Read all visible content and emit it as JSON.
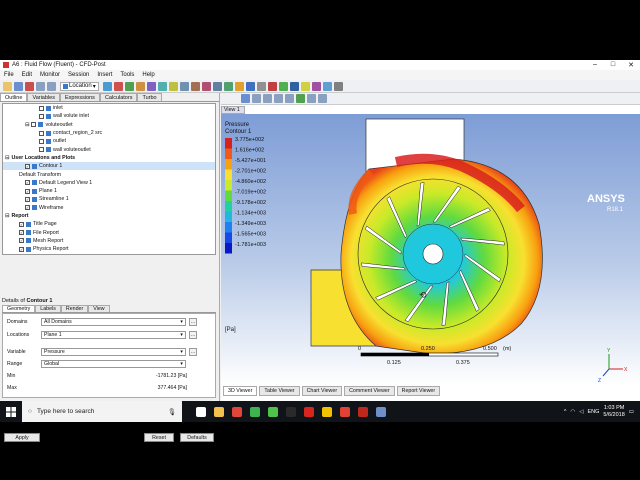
{
  "window": {
    "title": "A6 : Fluid Flow (Fluent) - CFD-Post"
  },
  "menu": [
    "File",
    "Edit",
    "Monitor",
    "Session",
    "Insert",
    "Tools",
    "Help"
  ],
  "toolbar": {
    "location_label": "Location"
  },
  "left_tabs": [
    "Outline",
    "Variables",
    "Expressions",
    "Calculators",
    "Turbo"
  ],
  "tree": [
    {
      "label": "inlet",
      "indent": 36,
      "check": false,
      "icon": true
    },
    {
      "label": "wall volute inlet",
      "indent": 36,
      "check": false,
      "icon": true
    },
    {
      "label": "voluteoutlet",
      "indent": 22,
      "check": false,
      "icon": true,
      "expander": "⊟"
    },
    {
      "label": "contact_region_2 src",
      "indent": 36,
      "check": false,
      "icon": true
    },
    {
      "label": "outlet",
      "indent": 36,
      "check": false,
      "icon": true
    },
    {
      "label": "wall voluteoutlet",
      "indent": 36,
      "check": false,
      "icon": true
    },
    {
      "label": "User Locations and Plots",
      "indent": 2,
      "bold": true,
      "expander": "⊟"
    },
    {
      "label": "Contour 1",
      "indent": 22,
      "check": true,
      "icon": true,
      "selected": true
    },
    {
      "label": "Default Transform",
      "indent": 16,
      "check": false,
      "icon": false
    },
    {
      "label": "Default Legend View 1",
      "indent": 22,
      "check": true,
      "icon": true
    },
    {
      "label": "Plane 1",
      "indent": 22,
      "check": true,
      "icon": true
    },
    {
      "label": "Streamline 1",
      "indent": 22,
      "check": true,
      "icon": true
    },
    {
      "label": "Wireframe",
      "indent": 22,
      "check": true,
      "icon": true
    },
    {
      "label": "Report",
      "indent": 2,
      "bold": true,
      "expander": "⊟"
    },
    {
      "label": "Title Page",
      "indent": 16,
      "check": true,
      "icon": true
    },
    {
      "label": "File Report",
      "indent": 16,
      "check": true,
      "icon": true
    },
    {
      "label": "Mesh Report",
      "indent": 16,
      "check": true,
      "icon": true
    },
    {
      "label": "Physics Report",
      "indent": 16,
      "check": true,
      "icon": true
    }
  ],
  "details": {
    "header_prefix": "Details of ",
    "header_name": "Contour 1",
    "tabs": [
      "Geometry",
      "Labels",
      "Render",
      "View"
    ],
    "domains_label": "Domains",
    "domains_value": "All Domains",
    "locations_label": "Locations",
    "locations_value": "Plane 1",
    "variable_label": "Variable",
    "variable_value": "Pressure",
    "range_label": "Range",
    "range_value": "Global",
    "min_label": "Min",
    "min_value": "-1781.23 [Pa]",
    "max_label": "Max",
    "max_value": "377.464 [Pa]",
    "apply": "Apply",
    "reset": "Reset",
    "defaults": "Defaults"
  },
  "view": {
    "tab": "View 1"
  },
  "legend": {
    "title": "Pressure",
    "subtitle": "Contour 1",
    "unit": "[Pa]",
    "values": [
      "3.775e+002",
      "1.616e+002",
      "-5.427e+001",
      "-2.701e+002",
      "-4.860e+002",
      "-7.019e+002",
      "-9.178e+002",
      "-1.134e+003",
      "-1.349e+003",
      "-1.565e+003",
      "-1.781e+003"
    ],
    "colors": [
      "#d8201e",
      "#f05a14",
      "#f8a010",
      "#f8e030",
      "#c8ea28",
      "#60da40",
      "#20d2a0",
      "#20b8e0",
      "#2080f0",
      "#1848e8",
      "#0a18c8"
    ]
  },
  "brand": {
    "name": "ANSYS",
    "version": "R18.1"
  },
  "scale": {
    "ticks": [
      "0",
      "0.250",
      "0.500"
    ],
    "unit": "(m)",
    "sub_ticks": [
      "0.125",
      "0.375"
    ]
  },
  "axis": {
    "y": "Y",
    "x": "X",
    "z": "Z"
  },
  "bottom_tabs": [
    "3D Viewer",
    "Table Viewer",
    "Chart Viewer",
    "Comment Viewer",
    "Report Viewer"
  ],
  "taskbar": {
    "search_placeholder": "Type here to search",
    "time": "1:03 PM",
    "date": "5/6/2018",
    "lang": "ENG"
  },
  "taskbar_icons": [
    {
      "name": "task-view-icon",
      "color": "#ffffff"
    },
    {
      "name": "file-explorer-icon",
      "color": "#f2c14e"
    },
    {
      "name": "chrome-icon",
      "color": "#e0463a"
    },
    {
      "name": "app-green-icon",
      "color": "#3fb34f"
    },
    {
      "name": "camtasia-icon",
      "color": "#4ec24a"
    },
    {
      "name": "terminal-icon",
      "color": "#2a2a2a"
    },
    {
      "name": "acrobat-icon",
      "color": "#d7261e"
    },
    {
      "name": "ansys-icon",
      "color": "#f2c200"
    },
    {
      "name": "gmail-icon",
      "color": "#e34133"
    },
    {
      "name": "app-red-icon",
      "color": "#c0281e"
    },
    {
      "name": "cfd-post-icon",
      "color": "#6e8fc8"
    }
  ]
}
